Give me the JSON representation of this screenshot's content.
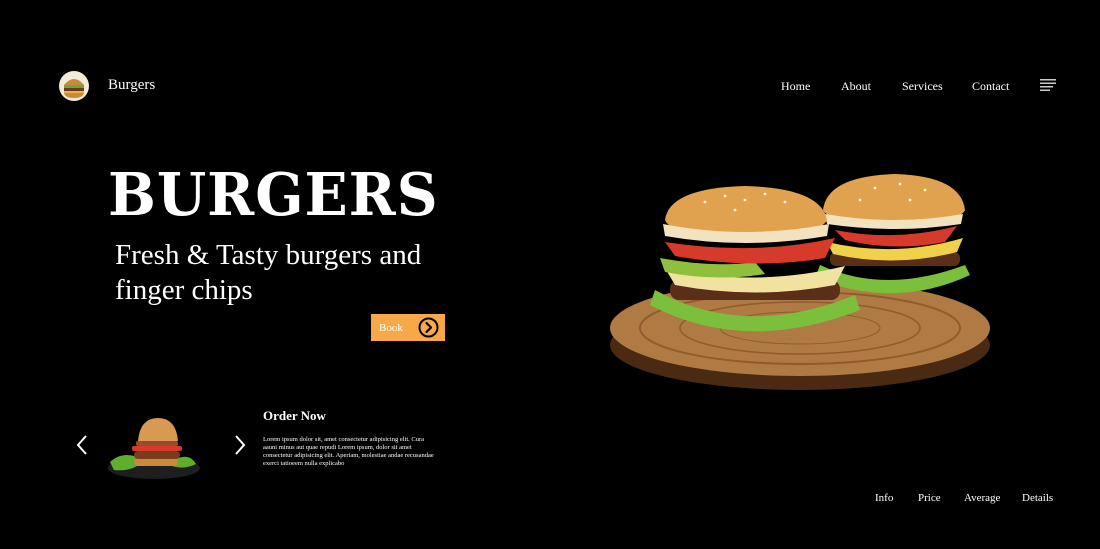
{
  "brand": {
    "name": "Burgers",
    "logo_icon": "burger-icon"
  },
  "nav": {
    "items": [
      {
        "label": "Home"
      },
      {
        "label": "About"
      },
      {
        "label": "Services"
      },
      {
        "label": "Contact"
      }
    ],
    "menu_icon": "menu-icon"
  },
  "hero": {
    "title": "BURGERS",
    "subtitle": "Fresh & Tasty burgers and finger chips",
    "book_label": "Book",
    "book_icon": "arrow-circle-right-icon",
    "accent": "#f7a94a"
  },
  "order": {
    "title": "Order Now",
    "text": "Lorem ipsum dolor sit, amet consectetur adipisicing elit. Cura aauni minus aut quae repudi Lorem ipsum, dolor sit amet consectetur adipisicing elit. Aperiam, molestiae andae recusandae exerci tatioeem nulla explicabo"
  },
  "bottom_links": [
    {
      "label": "Info"
    },
    {
      "label": "Price"
    },
    {
      "label": "Average"
    },
    {
      "label": "Details"
    }
  ]
}
